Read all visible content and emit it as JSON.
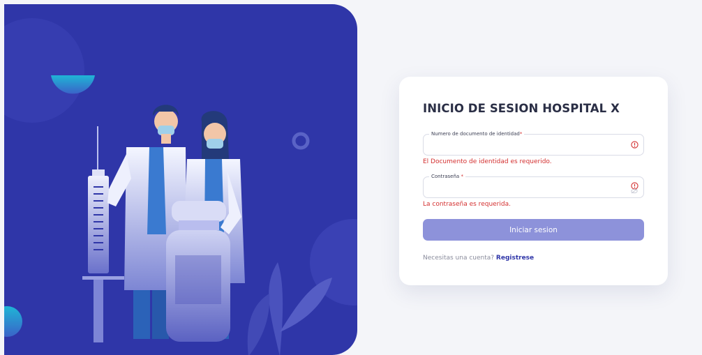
{
  "login": {
    "title": "INICIO DE SESION HOSPITAL X",
    "document_field": {
      "label": "Numero de documento de identidad",
      "required_mark": "*",
      "value": "",
      "error": "El Documento de identidad es requerido."
    },
    "password_field": {
      "label": "Contraseña ",
      "required_mark": "*",
      "value": "",
      "error": "La contraseña es requerida."
    },
    "submit_label": "Iniciar sesion",
    "signup_prompt": "Necesitas una cuenta? ",
    "signup_link": "Registrese"
  },
  "icons": {
    "field_error": "alert-circle-icon",
    "password_toggle": "eye-slash-icon"
  },
  "colors": {
    "panel": "#2f36a8",
    "accent": "#2f36a8",
    "button": "#8d92da",
    "error": "#d32f2f",
    "background": "#f4f5f9"
  }
}
